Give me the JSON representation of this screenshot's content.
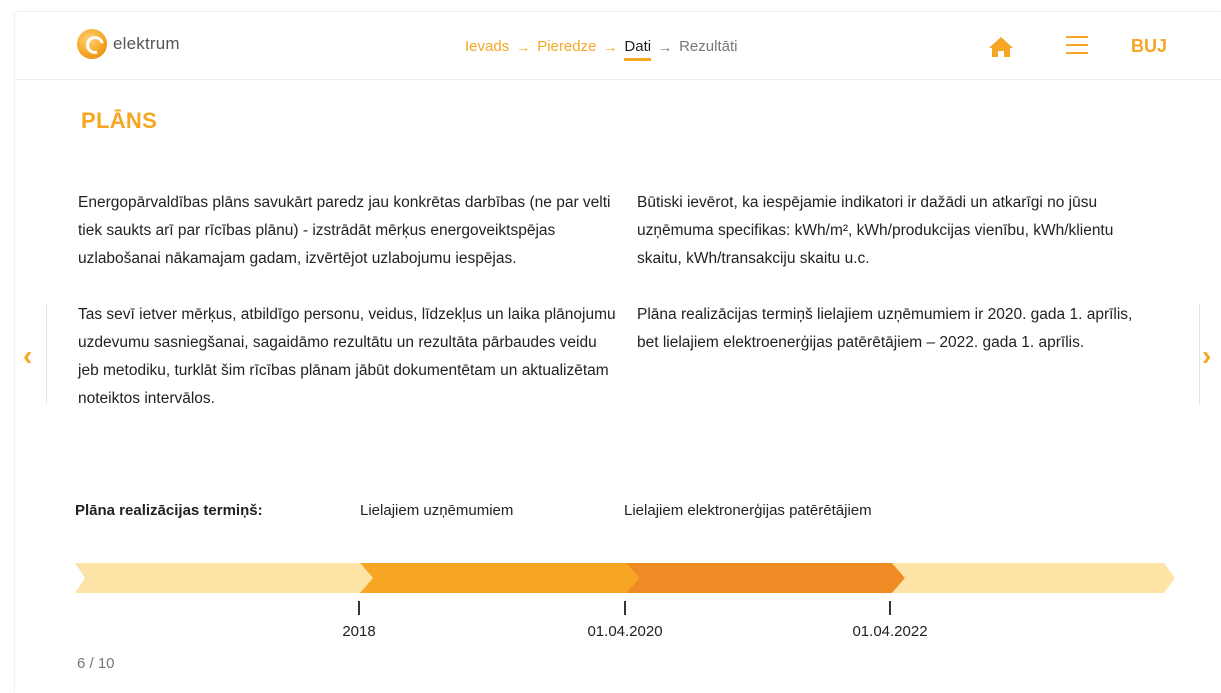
{
  "header": {
    "logo_text": "elektrum",
    "breadcrumb": [
      "Ievads",
      "Pieredze",
      "Dati",
      "Rezultāti"
    ],
    "lang": "BUJ"
  },
  "title": "PLĀNS",
  "left_paragraphs": [
    "Energopārvaldības plāns savukārt paredz jau konkrētas darbības (ne par velti tiek saukts arī par rīcības plānu) - izstrādāt mērķus energoveiktspējas uzlabošanai nākamajam gadam, izvērtējot uzlabojumu iespējas.",
    "Tas sevī ietver mērķus, atbildīgo personu, veidus, līdzekļus un laika plānojumu uzdevumu sasniegšanai, sagaidāmo rezultātu un rezultāta pārbaudes veidu jeb metodiku, turklāt šim rīcības plānam jābūt dokumentētam un aktualizētam noteiktos intervālos."
  ],
  "right_paragraphs": [
    "Būtiski ievērot, ka iespējamie indikatori ir dažādi un atkarīgi no jūsu uzņēmuma specifikas:  kWh/m², kWh/produkcijas vienību, kWh/klientu skaitu, kWh/transakciju skaitu u.c.",
    "Plāna realizācijas termiņš lielajiem uzņēmumiem ir 2020. gada 1. aprīlis, bet lielajiem elektroenerģijas patērētājiem – 2022. gada 1. aprīlis."
  ],
  "timeline": {
    "title": "Plāna realizācijas termiņš:",
    "label_companies": "Lielajiem uzņēmumiem",
    "label_consumers": "Lielajiem elektronerģijas patērētājiem",
    "dates": [
      "2018",
      "01.04.2020",
      "01.04.2022"
    ],
    "colors": {
      "light": "#fde4a6",
      "mid": "#f7a623",
      "dark": "#f08a24"
    }
  },
  "pager": "6 / 10"
}
